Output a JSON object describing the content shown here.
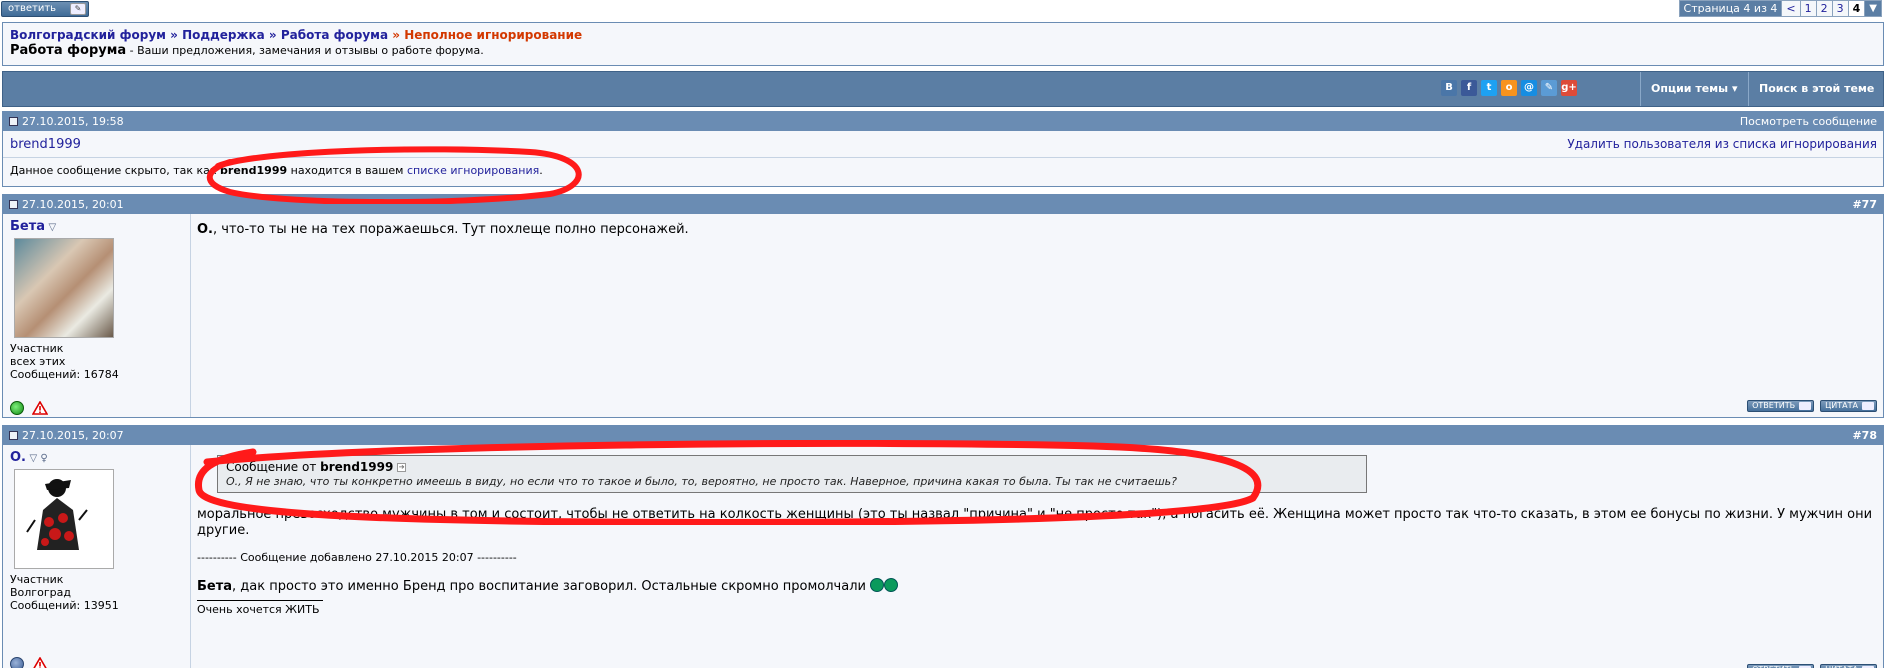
{
  "topbar": {
    "reply_label": "ответить",
    "page_label": "Страница 4 из 4",
    "prev": "<",
    "pages": [
      "1",
      "2",
      "3"
    ],
    "current_page": "4"
  },
  "breadcrumb": {
    "items": [
      "Волгоградский форум",
      "Поддержка",
      "Работа форума"
    ],
    "separator": "»",
    "current": "Неполное игнорирование",
    "forum_title": "Работа форума",
    "forum_desc": "- Ваши предложения, замечания и отзывы о работе форума."
  },
  "toolbar": {
    "share_icons": [
      {
        "name": "vk",
        "glyph": "В",
        "color": "#4a76a8"
      },
      {
        "name": "facebook",
        "glyph": "f",
        "color": "#3b5998"
      },
      {
        "name": "twitter",
        "glyph": "t",
        "color": "#1da1f2"
      },
      {
        "name": "odnoklassniki",
        "glyph": "o",
        "color": "#f7931e"
      },
      {
        "name": "mailru",
        "glyph": "@",
        "color": "#168de2"
      },
      {
        "name": "livejournal",
        "glyph": "✎",
        "color": "#5b9bd5"
      },
      {
        "name": "googleplus",
        "glyph": "g+",
        "color": "#dd4b39"
      }
    ],
    "thread_options": "Опции темы",
    "search_thread": "Поиск в этой теме"
  },
  "ignored_post": {
    "date": "27.10.2015, 19:58",
    "view_link": "Посмотреть сообщение",
    "username": "brend1999",
    "remove_link": "Удалить пользователя из списка игнорирования",
    "msg_before": "Данное сообщение скрыто, так как",
    "msg_user": "brend1999",
    "msg_middle": "находится в вашем",
    "msg_link": "списке игнорирования",
    "msg_end": "."
  },
  "post77": {
    "date": "27.10.2015, 20:01",
    "number": "#77",
    "username": "Бета",
    "rank": "Участник",
    "location": "всех этих",
    "posts": "Сообщений: 16784",
    "text_bold": "О.",
    "text": ", что-то ты не на тех поражаешься. Тут похлеще полно персонажей."
  },
  "post78": {
    "date": "27.10.2015, 20:07",
    "number": "#78",
    "username": "О.",
    "rank": "Участник",
    "location": "Волгоград",
    "posts": "Сообщений: 13951",
    "quote_from": "Сообщение от",
    "quote_user": "brend1999",
    "quote_text": "О., Я не знаю, что ты конкретно имеешь в виду, но если что то такое и было, то, вероятно, не просто так. Наверное, причина какая то была. Ты так не считаешь?",
    "text": "моральное превосходство мужчины в том и состоит, чтобы не ответить на колкость женщины (это ты назвал \"причина\" и \"не просто так\"), а погасить её. Женщина может просто так что-то сказать, в этом ее бонусы по жизни. У мужчин они другие.",
    "added": "---------- Сообщение добавлено 27.10.2015 20:07 ----------",
    "reply_bold": "Бета",
    "reply_text": ", дак просто это именно Бренд про воспитание заговорил. Остальные скромно промолчали",
    "signature": "Очень хочется ЖИТЬ"
  },
  "buttons": {
    "reply": "ответить",
    "quote": "цитата"
  },
  "colors": {
    "header_blue": "#6a8cb3",
    "toolbar_blue": "#5b7ea4",
    "link": "#22229c",
    "current_crumb": "#d33800",
    "highlight_red": "#ff1a1a"
  }
}
